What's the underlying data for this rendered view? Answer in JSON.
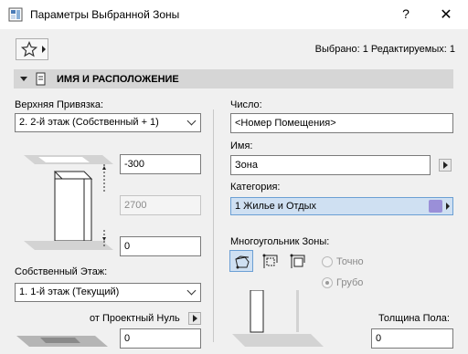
{
  "window": {
    "title": "Параметры Выбранной Зоны",
    "help_label": "?",
    "close_label": "✕"
  },
  "toolbar": {
    "favorites_icon": "star-icon",
    "selection_status": "Выбрано: 1 Редактируемых: 1"
  },
  "section": {
    "title": "ИМЯ И РАСПОЛОЖЕНИЕ"
  },
  "left": {
    "top_link_label": "Верхняя Привязка:",
    "top_link_value": "2. 2-й этаж (Собственный + 1)",
    "top_offset_value": "-300",
    "height_value": "2700",
    "bottom_offset_value": "0",
    "home_story_label": "Собственный Этаж:",
    "home_story_value": "1. 1-й этаж (Текущий)",
    "reference_label": "от Проектный Нуль",
    "reference_value": "0"
  },
  "right": {
    "number_label": "Число:",
    "number_value": "<Номер Помещения>",
    "name_label": "Имя:",
    "name_value": "Зона",
    "category_label": "Категория:",
    "category_value": "1  Жилье и Отдых",
    "category_color": "#9a8fd8",
    "polygon_label": "Многоугольник Зоны:",
    "precise_label": "Точно",
    "rough_label": "Грубо",
    "floor_thickness_label": "Толщина Пола:",
    "floor_thickness_value": "0"
  },
  "colors": {
    "section_bar": "#d6d6d6",
    "selection_highlight": "#cfe0f2",
    "selection_border": "#6b9fd4"
  }
}
